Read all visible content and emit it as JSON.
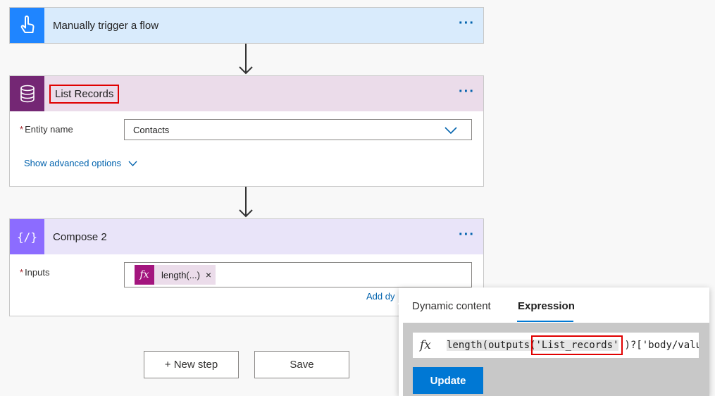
{
  "trigger": {
    "title": "Manually trigger a flow",
    "more": "···"
  },
  "list_records": {
    "title": "List Records",
    "more": "···",
    "entity_label": "Entity name",
    "entity_value": "Contacts",
    "advanced_link": "Show advanced options"
  },
  "compose": {
    "title": "Compose 2",
    "more": "···",
    "inputs_label": "Inputs",
    "token_icon": "fx",
    "token_label": "length(...)",
    "token_remove": "×",
    "add_dynamic": "Add dy"
  },
  "footer": {
    "new_step": "+ New step",
    "save": "Save"
  },
  "popup": {
    "tab_dynamic": "Dynamic content",
    "tab_expression": "Expression",
    "fx": "fx",
    "expr_prefix": "length(outputs(",
    "expr_highlight": "'List_records'",
    "expr_suffix": ")?['body/valu",
    "update": "Update"
  },
  "colors": {
    "trigger_header": "#d9ebfc",
    "trigger_icon": "#1f85ff",
    "list_header": "#ebdcea",
    "list_icon": "#742774",
    "compose_header": "#e9e4f9",
    "compose_icon": "#8c6cff",
    "accent": "#0078d4",
    "highlight_border": "#e00000"
  }
}
